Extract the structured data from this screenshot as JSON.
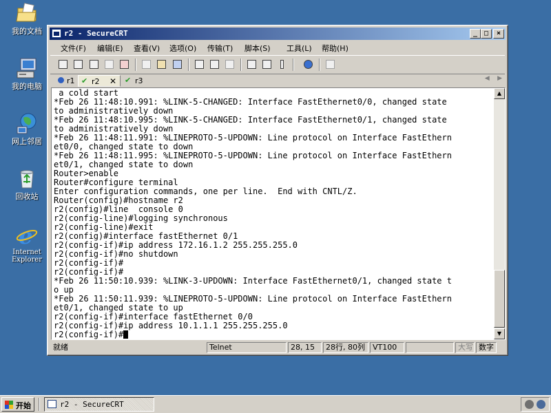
{
  "desktop": {
    "icons": [
      {
        "label": "我的文档"
      },
      {
        "label": "我的电脑"
      },
      {
        "label": "网上邻居"
      },
      {
        "label": "回收站"
      },
      {
        "label_line1": "Internet",
        "label_line2": "Explorer"
      }
    ]
  },
  "window": {
    "title": "r2 - SecureCRT",
    "menu": [
      "文件(F)",
      "编辑(E)",
      "查看(V)",
      "选项(O)",
      "传输(T)",
      "脚本(S)",
      "工具(L)",
      "帮助(H)"
    ],
    "tabs": [
      {
        "label": "r1",
        "state": "info"
      },
      {
        "label": "r2",
        "state": "connected",
        "active": true
      },
      {
        "label": "r3",
        "state": "connected"
      }
    ],
    "terminal_lines": [
      " a cold start",
      "*Feb 26 11:48:10.991: %LINK-5-CHANGED: Interface FastEthernet0/0, changed state",
      "to administratively down",
      "*Feb 26 11:48:10.995: %LINK-5-CHANGED: Interface FastEthernet0/1, changed state",
      "to administratively down",
      "*Feb 26 11:48:11.991: %LINEPROTO-5-UPDOWN: Line protocol on Interface FastEthern",
      "et0/0, changed state to down",
      "*Feb 26 11:48:11.995: %LINEPROTO-5-UPDOWN: Line protocol on Interface FastEthern",
      "et0/1, changed state to down",
      "Router>enable",
      "Router#configure terminal",
      "Enter configuration commands, one per line.  End with CNTL/Z.",
      "Router(config)#hostname r2",
      "r2(config)#line  console 0",
      "r2(config-line)#logging synchronous",
      "r2(config-line)#exit",
      "r2(config)#interface fastEthernet 0/1",
      "r2(config-if)#ip address 172.16.1.2 255.255.255.0",
      "r2(config-if)#no shutdown",
      "r2(config-if)#",
      "r2(config-if)#",
      "*Feb 26 11:50:10.939: %LINK-3-UPDOWN: Interface FastEthernet0/1, changed state t",
      "o up",
      "*Feb 26 11:50:11.939: %LINEPROTO-5-UPDOWN: Line protocol on Interface FastEthern",
      "et0/1, changed state to up",
      "r2(config-if)#interface fastEthernet 0/0",
      "r2(config-if)#ip address 10.1.1.1 255.255.255.0"
    ],
    "prompt": "r2(config-if)#",
    "status": {
      "ready": "就绪",
      "protocol": "Telnet",
      "cursor_pos": "28, 15",
      "rows_cols": "28行, 80列",
      "emulation": "VT100",
      "caps": "大写",
      "num": "数字"
    }
  },
  "taskbar": {
    "start_label": "开始",
    "task_title": "r2 - SecureCRT"
  }
}
